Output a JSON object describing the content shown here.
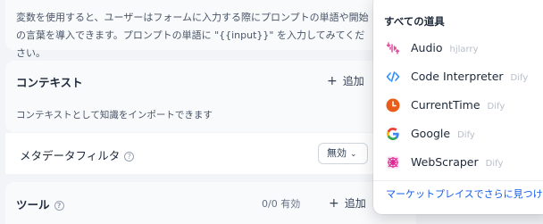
{
  "variables_hint": "変数を使用すると、ユーザーはフォームに入力する際にプロンプトの単語や開始の言葉を導入できます。プロンプトの単語に \"{{input}}\" を入力してみてください。",
  "context": {
    "title": "コンテキスト",
    "add_label": "追加",
    "description": "コンテキストとして知識をインポートできます"
  },
  "metadata_filter": {
    "label": "メタデータフィルタ",
    "help": "?",
    "value": "無効"
  },
  "tools": {
    "title": "ツール",
    "help": "?",
    "count": "0/0 有効",
    "add_label": "追加"
  },
  "dropdown": {
    "title": "すべての道具",
    "items": [
      {
        "name": "Audio",
        "author": "hjlarry",
        "icon": "audio-icon",
        "color": "#e04f9f"
      },
      {
        "name": "Code Interpreter",
        "author": "Dify",
        "icon": "code-icon",
        "color": "#2e90fa"
      },
      {
        "name": "CurrentTime",
        "author": "Dify",
        "icon": "clock-icon",
        "color": "#e85d1a"
      },
      {
        "name": "Google",
        "author": "Dify",
        "icon": "google-icon",
        "color": "#4285f4"
      },
      {
        "name": "WebScraper",
        "author": "Dify",
        "icon": "webscraper-icon",
        "color": "#dd2590"
      }
    ],
    "marketplace_link": "マーケットプレイスでさらに見つけてください"
  }
}
